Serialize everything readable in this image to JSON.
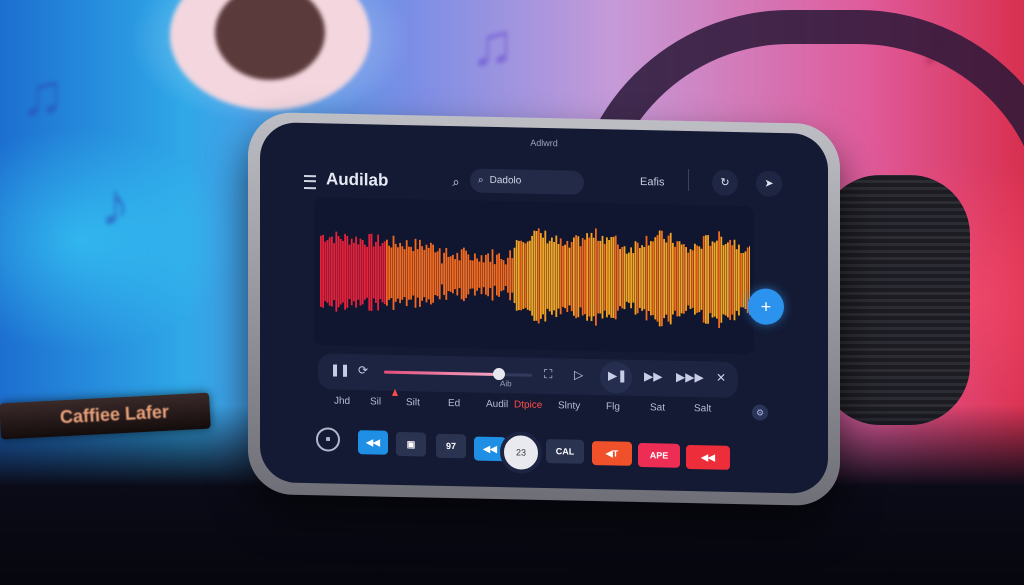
{
  "scene": {
    "pen_label": "Caffiee Lafer"
  },
  "app": {
    "caption": "Adlwrd",
    "title": "Audilab",
    "search_placeholder_value": "Dadolo",
    "edits_label": "Eafis",
    "round_buttons": [
      {
        "icon": "redo-icon",
        "glyph": "↻"
      },
      {
        "icon": "share-icon",
        "glyph": "➤"
      }
    ],
    "fab": {
      "icon": "plus-icon",
      "glyph": "+"
    }
  },
  "waveform": {
    "colors": {
      "start": "#e8213a",
      "mid": "#f26a1f",
      "end": "#f3a423"
    }
  },
  "transport": {
    "progress": 0.78,
    "position_label": "Aib",
    "controls": [
      {
        "name": "pause-icon",
        "glyph": "❚❚"
      },
      {
        "name": "loop-icon",
        "glyph": "⟳"
      },
      {
        "name": "crop-icon",
        "glyph": "⛶"
      },
      {
        "name": "play-icon",
        "glyph": "▷"
      },
      {
        "name": "play-next-icon",
        "glyph": "▶❚"
      },
      {
        "name": "fast-forward-icon",
        "glyph": "▶▶"
      },
      {
        "name": "skip-forward-icon",
        "glyph": "▶▶▶"
      },
      {
        "name": "shuffle-icon",
        "glyph": "✕"
      }
    ]
  },
  "labels": [
    {
      "text": "Jhd",
      "active": false
    },
    {
      "text": "Sil",
      "active": false
    },
    {
      "text": "Silt",
      "active": false
    },
    {
      "text": "Ed",
      "active": false
    },
    {
      "text": "Audil",
      "active": false
    },
    {
      "text": "Dtpice",
      "active": true
    },
    {
      "text": "Slnty",
      "active": false
    },
    {
      "text": "Flg",
      "active": false
    },
    {
      "text": "Sat",
      "active": false
    },
    {
      "text": "Salt",
      "active": false
    }
  ],
  "buttons": [
    {
      "label": "◀◀",
      "color": "#1f8fe6",
      "name": "rewind-button"
    },
    {
      "label": "▣",
      "color": "#2a3350",
      "name": "save-button"
    },
    {
      "label": "97",
      "color": "#2a3350",
      "name": "value-97-button"
    },
    {
      "label": "◀◀",
      "color": "#1f8fe6",
      "name": "rewind-button-2"
    },
    {
      "label": "CAL",
      "color": "#2a3350",
      "name": "cal-button"
    },
    {
      "label": "◀T",
      "color": "#f0502a",
      "name": "trim-button"
    },
    {
      "label": "APE",
      "color": "#ee2d55",
      "name": "ape-button"
    },
    {
      "label": "◀◀",
      "color": "#ee2d3a",
      "name": "rewind-button-red"
    }
  ],
  "dial_value": "23",
  "lock_icon_glyph": "🔒"
}
